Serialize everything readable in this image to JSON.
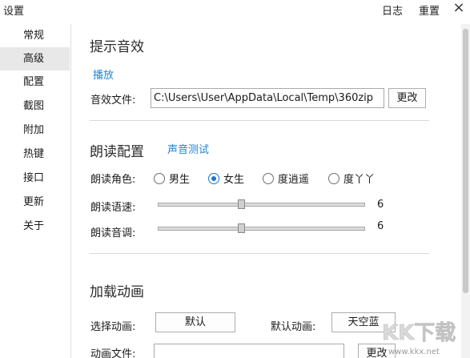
{
  "window": {
    "title": "设置",
    "links": {
      "log": "日志",
      "reset": "重置"
    },
    "close_glyph": "×"
  },
  "sidebar": {
    "items": [
      {
        "label": "常规"
      },
      {
        "label": "高级",
        "active": true
      },
      {
        "label": "配置"
      },
      {
        "label": "截图"
      },
      {
        "label": "附加"
      },
      {
        "label": "热键"
      },
      {
        "label": "接口"
      },
      {
        "label": "更新"
      },
      {
        "label": "关于"
      }
    ]
  },
  "sound": {
    "title": "提示音效",
    "play_link": "播放",
    "file_label": "音效文件:",
    "file_value": "C:\\Users\\User\\AppData\\Local\\Temp\\360zip",
    "change_button": "更改"
  },
  "reading": {
    "title": "朗读配置",
    "test_link": "声音测试",
    "role_label": "朗读角色:",
    "roles": [
      {
        "label": "男生",
        "checked": false
      },
      {
        "label": "女生",
        "checked": true
      },
      {
        "label": "度逍遥",
        "checked": false
      },
      {
        "label": "度丫丫",
        "checked": false
      }
    ],
    "speed_label": "朗读语速:",
    "speed_value": "6",
    "speed_fraction": 0.4,
    "pitch_label": "朗读音调:",
    "pitch_value": "6",
    "pitch_fraction": 0.4
  },
  "animation": {
    "title": "加载动画",
    "select_label": "选择动画:",
    "select_value": "默认",
    "default_label": "默认动画:",
    "default_value": "天空蓝",
    "file_label": "动画文件:",
    "file_value": "",
    "change_button": "更改"
  },
  "watermark": {
    "brand": "KK下载",
    "url": "www.kkx.net"
  },
  "colors": {
    "accent": "#1f86d6",
    "sidebar_active": "#e8e8e8"
  }
}
